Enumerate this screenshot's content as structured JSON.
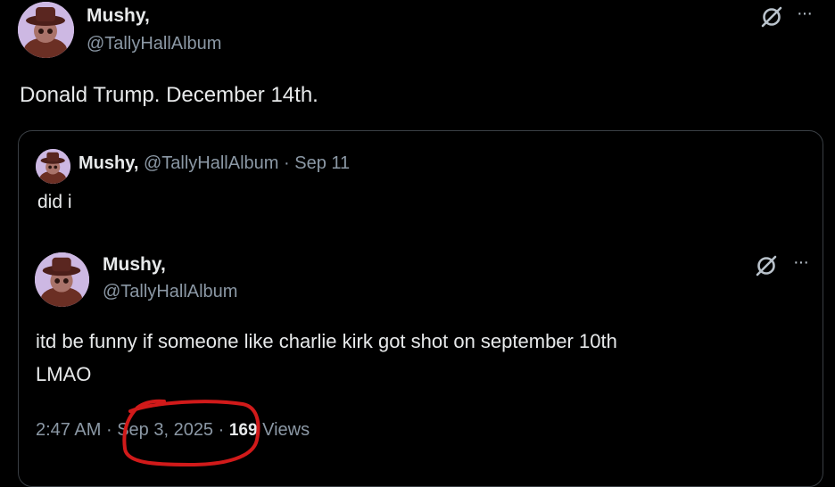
{
  "main_tweet": {
    "display_name": "Mushy,",
    "handle": "@TallyHallAlbum",
    "text": "Donald Trump. December 14th.",
    "more_label": "···",
    "grok_icon": "grok-slash-icon"
  },
  "quoted_tweet": {
    "display_name": "Mushy,",
    "handle": "@TallyHallAlbum",
    "dot": "·",
    "date": "Sep 11",
    "text": "did i"
  },
  "nested_tweet": {
    "display_name": "Mushy,",
    "handle": "@TallyHallAlbum",
    "text_line1": "itd be funny if someone like charlie kirk got shot on september 10th",
    "text_line2": "LMAO",
    "time": "2:47 AM",
    "dot": "·",
    "date": "Sep 3, 2025",
    "views_count": "169",
    "views_label": "Views",
    "more_label": "···",
    "grok_icon": "grok-slash-icon"
  },
  "annotation_color": "#d11a1a"
}
